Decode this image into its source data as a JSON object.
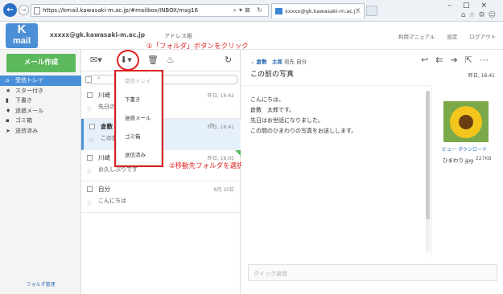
{
  "browser": {
    "url": "https://kmail.kawasaki-m.ac.jp/#mailbox/INBOX/msg16",
    "tab_title": "xxxxx@gk.kawasaki-m.ac.j..."
  },
  "header": {
    "logo_k": "K",
    "logo_mail": "mail",
    "account": "xxxxx@gk.kawasaki-m.ac.jp",
    "addressbook": "アドレス帳",
    "links": [
      "利用マニュアル",
      "設定",
      "ログアウト"
    ],
    "annotation": "①「フォルダ」ボタンをクリック"
  },
  "sidebar": {
    "compose": "メール作成",
    "folders": [
      {
        "icon": "inbox",
        "label": "受信トレイ",
        "active": true
      },
      {
        "icon": "star",
        "label": "スター付き"
      },
      {
        "icon": "draft",
        "label": "下書き"
      },
      {
        "icon": "spam",
        "label": "迷惑メール"
      },
      {
        "icon": "trash",
        "label": "ゴミ箱"
      },
      {
        "icon": "sent",
        "label": "送信済み"
      }
    ],
    "folder_admin": "フォルダ管理"
  },
  "list": {
    "messages": [
      {
        "from": "川崎",
        "subject": "先日の",
        "date": "昨日, 16:42"
      },
      {
        "from": "倉敷",
        "subject": "この前",
        "date": "昨日, 16:41"
      },
      {
        "from": "川崎",
        "subject": "お久しぶりです",
        "date": "昨日, 16:05"
      },
      {
        "from": "自分",
        "subject": "こんにちは",
        "date": "8月 10日"
      }
    ]
  },
  "dropdown": {
    "options": [
      "受信トレイ",
      "下書き",
      "迷惑メール",
      "ゴミ箱",
      "送信済み"
    ],
    "annotation": "②移動先フォルダを選択"
  },
  "reading": {
    "from_name": "倉敷　太郎",
    "to_label": "宛先",
    "to_name": "自分",
    "subject": "この前の写真",
    "date": "昨日, 16:41",
    "body": [
      "こんにちは。",
      "倉敷　太郎です。",
      "先日はお世話になりました。",
      "この間のひまわりの写真をお送しします。"
    ],
    "attachment": {
      "view": "ビュー",
      "download": "ダウンロード",
      "name": "ひまわり.jpg",
      "size": "227KB"
    },
    "quick_reply": "クイック返信"
  }
}
